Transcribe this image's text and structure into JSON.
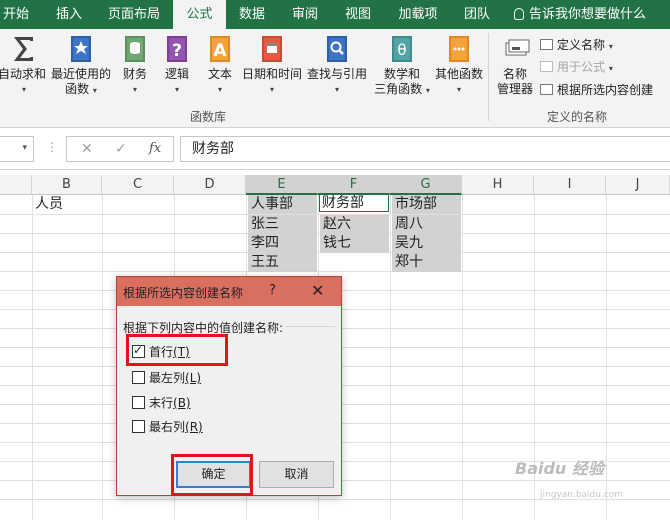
{
  "ribbon_tabs": [
    "开始",
    "插入",
    "页面布局",
    "公式",
    "数据",
    "审阅",
    "视图",
    "加载项",
    "团队"
  ],
  "active_tab": "公式",
  "tell_me": "告诉我你想要做什么",
  "function_library": {
    "autosum": "自动求和",
    "recent_line1": "最近使用的",
    "recent_line2": "函数",
    "financial": "财务",
    "logical": "逻辑",
    "text": "文本",
    "datetime": "日期和时间",
    "lookup": "查找与引用",
    "math_line1": "数学和",
    "math_line2": "三角函数",
    "other": "其他函数",
    "group_label": "函数库"
  },
  "defined_names": {
    "name_manager_line1": "名称",
    "name_manager_line2": "管理器",
    "define_name": "定义名称",
    "use_in_formula": "用于公式",
    "create_from_selection": "根据所选内容创建",
    "group_label": "定义的名称"
  },
  "formula_bar": {
    "cancel_glyph": "✕",
    "enter_glyph": "✓",
    "fx_glyph": "fx",
    "value": "财务部"
  },
  "columns": [
    "B",
    "C",
    "D",
    "E",
    "F",
    "G",
    "H",
    "I",
    "J"
  ],
  "cells": {
    "b1": "人员",
    "e1": "人事部",
    "e2": "张三",
    "e3": "李四",
    "e4": "王五",
    "f1": "财务部",
    "f2": "赵六",
    "f3": "钱七",
    "g1": "市场部",
    "g2": "周八",
    "g3": "吴九",
    "g4": "郑十"
  },
  "dialog": {
    "title": "根据所选内容创建名称",
    "help": "?",
    "close": "✕",
    "prompt": "根据下列内容中的值创建名称:",
    "options": [
      {
        "label": "首行",
        "key": "(T)",
        "checked": true
      },
      {
        "label": "最左列",
        "key": "(L)",
        "checked": false
      },
      {
        "label": "末行",
        "key": "(B)",
        "checked": false
      },
      {
        "label": "最右列",
        "key": "(R)",
        "checked": false
      }
    ],
    "ok": "确定",
    "cancel": "取消"
  },
  "watermark": {
    "brand": "Baidu 经验",
    "url": "jingyan.baidu.com"
  },
  "colors": {
    "excel_green": "#217346",
    "dialog_title": "#d86f5f",
    "highlight_red": "#e0151e"
  }
}
